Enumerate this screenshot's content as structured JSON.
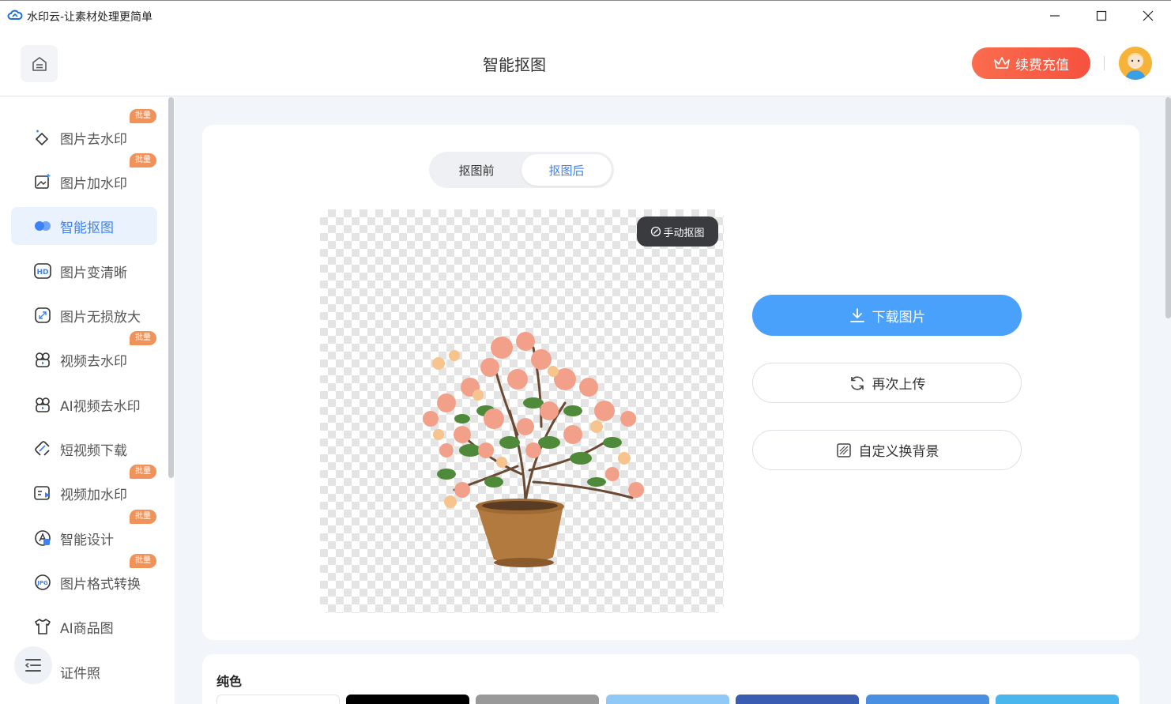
{
  "window": {
    "title": "水印云-让素材处理更简单",
    "controls": [
      "minimize-icon",
      "maximize-icon",
      "close-icon"
    ]
  },
  "header": {
    "title": "智能抠图",
    "recharge_label": "续费充值"
  },
  "sidebar": {
    "items": [
      {
        "label": "图片去水印",
        "badge": "批量",
        "icon": "eraser-icon"
      },
      {
        "label": "图片加水印",
        "badge": "批量",
        "icon": "image-add-icon"
      },
      {
        "label": "智能抠图",
        "badge": "",
        "icon": "cutout-icon",
        "active": true
      },
      {
        "label": "图片变清晰",
        "badge": "",
        "icon": "hd-icon"
      },
      {
        "label": "图片无损放大",
        "badge": "",
        "icon": "enlarge-icon"
      },
      {
        "label": "视频去水印",
        "badge": "批量",
        "icon": "video-eraser-icon"
      },
      {
        "label": "AI视频去水印",
        "badge": "",
        "icon": "ai-video-icon"
      },
      {
        "label": "短视频下载",
        "badge": "",
        "icon": "link-download-icon"
      },
      {
        "label": "视频加水印",
        "badge": "批量",
        "icon": "video-add-icon"
      },
      {
        "label": "智能设计",
        "badge": "批量",
        "icon": "design-icon"
      },
      {
        "label": "图片格式转换",
        "badge": "批量",
        "icon": "jpg-icon"
      },
      {
        "label": "AI商品图",
        "badge": "",
        "icon": "shirt-icon"
      },
      {
        "label": "证件照",
        "badge": "",
        "icon": "id-photo-icon"
      }
    ]
  },
  "main": {
    "tabs": [
      {
        "label": "抠图前",
        "active": false
      },
      {
        "label": "抠图后",
        "active": true
      }
    ],
    "manual_label": "手动抠图",
    "download_label": "下载图片",
    "reupload_label": "再次上传",
    "custom_bg_label": "自定义换背景"
  },
  "background": {
    "title": "纯色",
    "swatches": [
      "#ffffff",
      "#000000",
      "#999999",
      "#8ec9f7",
      "#3a5db3",
      "#4a90e2",
      "#4ab6ee"
    ]
  },
  "colors": {
    "accent": "#4aa1fc",
    "recharge": "#f5523f",
    "badge": "#f0935a"
  }
}
